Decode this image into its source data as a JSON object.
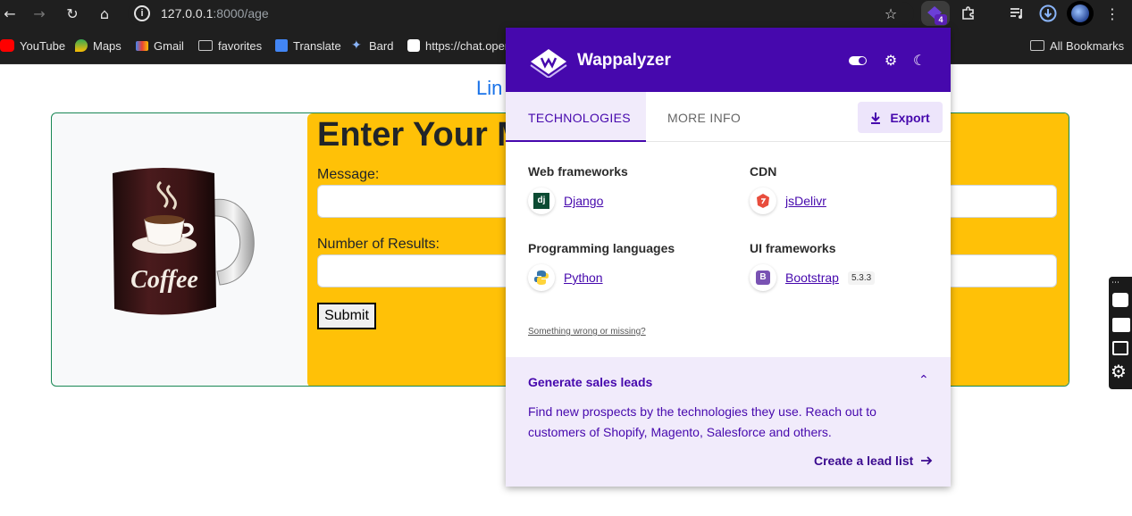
{
  "browser": {
    "url_host": "127.0.0.1",
    "url_path": ":8000/age",
    "extension_badge_count": "4"
  },
  "bookmarks": [
    {
      "label": "YouTube",
      "icon": "youtube-icon"
    },
    {
      "label": "Maps",
      "icon": "maps-icon"
    },
    {
      "label": "Gmail",
      "icon": "gmail-icon"
    },
    {
      "label": "favorites",
      "icon": "folder-icon"
    },
    {
      "label": "Translate",
      "icon": "translate-icon"
    },
    {
      "label": "Bard",
      "icon": "bard-icon"
    },
    {
      "label": "https://chat.oper",
      "icon": "chatgpt-icon"
    },
    {
      "label": "All Bookmarks",
      "icon": "folder-icon"
    }
  ],
  "page": {
    "link_text": "Lin",
    "heading": "Enter Your M",
    "message_label": "Message:",
    "results_label": "Number of Results:",
    "submit_label": "Submit",
    "mug_text": "Coffee"
  },
  "wappalyzer": {
    "title": "Wappalyzer",
    "tabs": {
      "technologies": "TECHNOLOGIES",
      "more_info": "MORE INFO"
    },
    "export_label": "Export",
    "categories": {
      "web_frameworks": {
        "title": "Web frameworks",
        "tech": "Django"
      },
      "cdn": {
        "title": "CDN",
        "tech": "jsDelivr"
      },
      "programming_languages": {
        "title": "Programming languages",
        "tech": "Python"
      },
      "ui_frameworks": {
        "title": "UI frameworks",
        "tech": "Bootstrap",
        "version": "5.3.3"
      }
    },
    "wrong_link": "Something wrong or missing?",
    "leads": {
      "title": "Generate sales leads",
      "body": "Find new prospects by the technologies they use. Reach out to customers of Shopify, Magento, Salesforce and others.",
      "cta": "Create a lead list"
    },
    "colors": {
      "brand": "#4608ad",
      "tab_bg": "#f1ebfb"
    }
  }
}
